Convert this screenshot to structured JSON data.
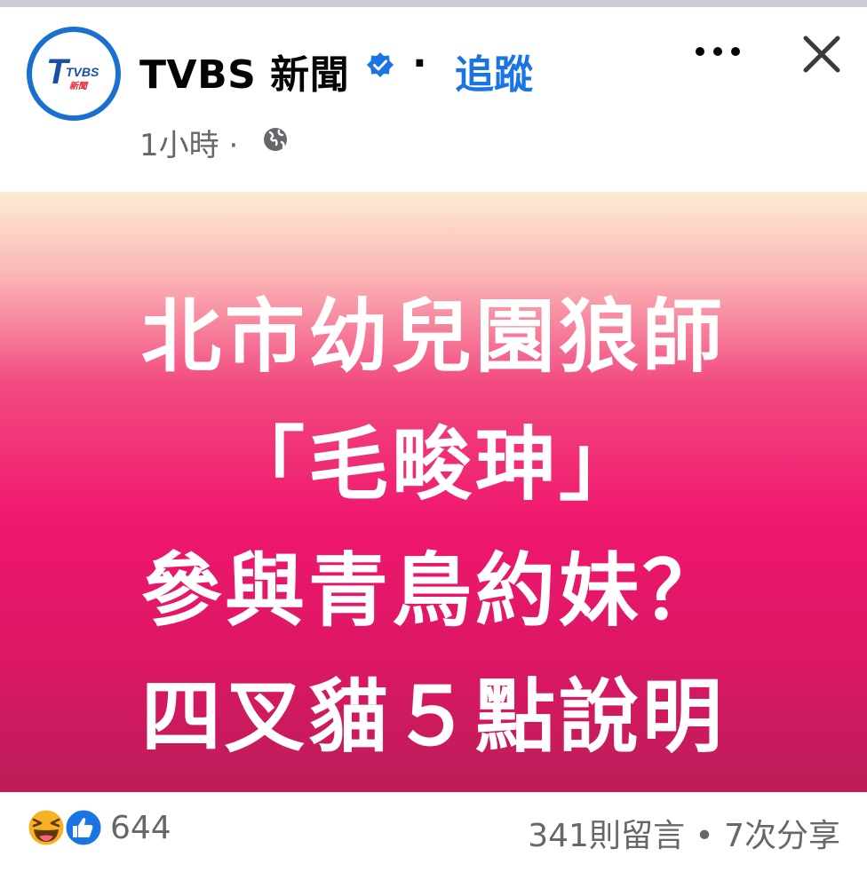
{
  "post": {
    "page_name": "TVBS 新聞",
    "separator": "·",
    "follow_label": "追蹤",
    "time_text": "1小時 ·",
    "avatar_logo_text": "TVBS",
    "avatar_logo_sub": "新聞",
    "verified_icon": "verified-badge-icon",
    "privacy_icon": "globe-icon"
  },
  "banner": {
    "lines": [
      "北市幼兒園狼師",
      "「毛畯珅」",
      "參與青鳥約妹？",
      "四叉貓５點說明"
    ]
  },
  "footer": {
    "like_count": "644",
    "comments_shares": "341則留言 • 7次分享",
    "reaction_icons": [
      "haha-reaction-icon",
      "like-reaction-icon"
    ]
  },
  "colors": {
    "accent": "#1b74e4",
    "text_primary": "#050505",
    "text_secondary": "#65676b",
    "banner_gradient_top": "#fcecd2",
    "banner_gradient_mid": "#ef176e",
    "banner_gradient_bottom": "#bc1d59"
  }
}
